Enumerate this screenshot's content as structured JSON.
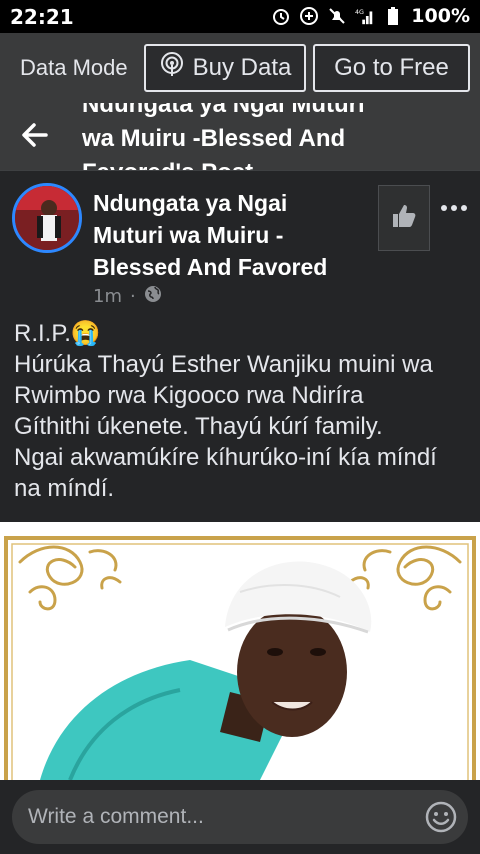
{
  "status_bar": {
    "time": "22:21",
    "battery_percent": "100%",
    "network": "4G"
  },
  "data_banner": {
    "mode_label": "Data Mode",
    "buy_label": "Buy Data",
    "free_label": "Go to Free"
  },
  "header": {
    "title": "Ndungata ya Ngai Muturi wa Muiru -Blessed And Favored's Post"
  },
  "post": {
    "author": "Ndungata ya Ngai Muturi wa Muiru -Blessed And Favored",
    "time_ago": "1m",
    "separator": "·",
    "privacy_icon": "globe-icon",
    "text_lines": [
      "R.I.P.😭",
      "Húrúka Thayú Esther Wanjiku muini wa",
      "Rwimbo rwa Kigooco rwa Ndiríra",
      "Gíthithi úkenete. Thayú kúrí family.",
      "Ngai akwamúkíre kíhurúko-iní kía míndí",
      "na míndí."
    ]
  },
  "comment": {
    "placeholder": "Write a comment..."
  },
  "colors": {
    "banner_bg": "#3a3b3c",
    "page_bg": "#242527",
    "accent_blue": "#2d88ff",
    "gold": "#c9a24a"
  }
}
